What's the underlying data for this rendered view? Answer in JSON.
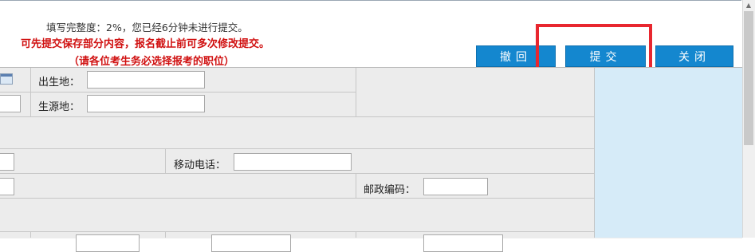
{
  "header": {
    "progress_text": "填写完整度：2%，您已经6分钟未进行提交。",
    "notice_line1": "可先提交保存部分内容，报名截止前可多次修改提交。",
    "notice_line2": "（请各位考生务必选择报考的职位）"
  },
  "toolbar": {
    "withdraw_label": "撤回",
    "submit_label": "提交",
    "close_label": "关闭",
    "button_color": "#1487cf",
    "highlight_color": "#e8272f"
  },
  "form": {
    "birthplace_label": "出生地：",
    "birthplace_value": "",
    "origin_label": "生源地：",
    "origin_value": "",
    "mobile_label": "移动电话：",
    "mobile_value": "",
    "postcode_label": "邮政编码：",
    "postcode_value": ""
  },
  "icons": {
    "calendar": "calendar-icon"
  }
}
